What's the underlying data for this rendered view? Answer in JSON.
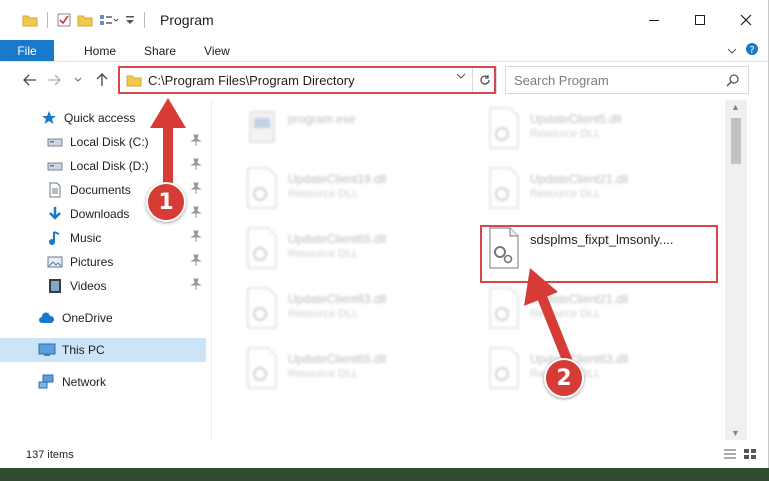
{
  "window": {
    "title": "Program",
    "ribbon": {
      "file": "File",
      "tabs": [
        "Home",
        "Share",
        "View"
      ]
    }
  },
  "nav": {
    "address": "C:\\Program Files\\Program Directory",
    "search_placeholder": "Search Program"
  },
  "sidebar": {
    "quick_access": "Quick access",
    "items": [
      {
        "label": "Local Disk (C:)",
        "icon": "drive-icon",
        "pinned": true
      },
      {
        "label": "Local Disk (D:)",
        "icon": "drive-icon",
        "pinned": true
      },
      {
        "label": "Documents",
        "icon": "documents-icon",
        "pinned": true
      },
      {
        "label": "Downloads",
        "icon": "downloads-icon",
        "pinned": true
      },
      {
        "label": "Music",
        "icon": "music-icon",
        "pinned": true
      },
      {
        "label": "Pictures",
        "icon": "pictures-icon",
        "pinned": true
      },
      {
        "label": "Videos",
        "icon": "videos-icon",
        "pinned": true
      }
    ],
    "onedrive": "OneDrive",
    "this_pc": "This PC",
    "network": "Network"
  },
  "files": [
    {
      "name": "program.exe",
      "type": ""
    },
    {
      "name": "UpdateClient5.dll",
      "type": "Resource DLL"
    },
    {
      "name": "UpdateClient19.dll",
      "type": "Resource DLL"
    },
    {
      "name": "UpdateClient21.dll",
      "type": "Resource DLL"
    },
    {
      "name": "UpdateClient65.dll",
      "type": "Resource DLL"
    },
    {
      "name": "sdsplms_fixpt_lmsonly....",
      "type": ""
    },
    {
      "name": "UpdateClient63.dll",
      "type": "Resource DLL"
    },
    {
      "name": "UpdateClient21.dll",
      "type": "Resource DLL"
    },
    {
      "name": "UpdateClient65.dll",
      "type": "Resource DLL"
    },
    {
      "name": "UpdateClient63.dll",
      "type": "Resource DLL"
    }
  ],
  "status": {
    "items": "137 items"
  },
  "annotations": {
    "marker1": "1",
    "marker2": "2"
  },
  "colors": {
    "accent": "#1979ca",
    "highlight": "#d94848",
    "marker": "#d63b35",
    "selected": "#cce4f7"
  }
}
